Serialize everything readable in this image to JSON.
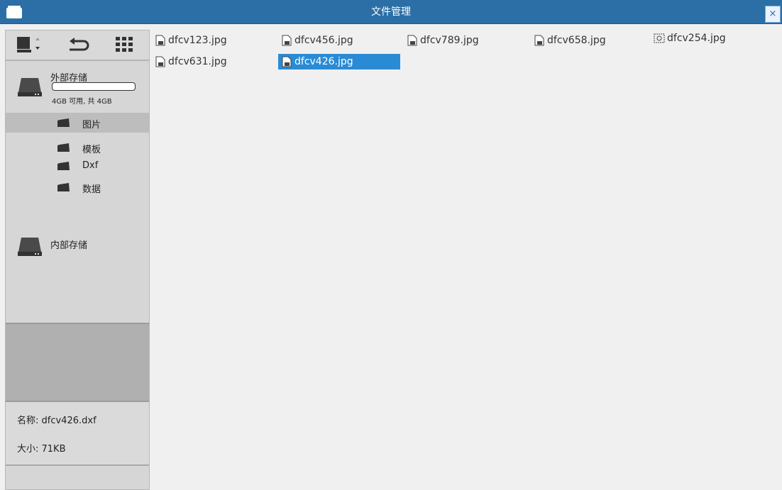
{
  "window": {
    "title": "文件管理",
    "close_label": "×"
  },
  "sidebar": {
    "external_drive": {
      "name": "外部存储",
      "capacity_text": "4GB 可用, 共 4GB"
    },
    "folders": [
      {
        "label": "图片",
        "selected": true
      },
      {
        "label": "模板",
        "selected": false
      },
      {
        "label": "Dxf",
        "selected": false
      },
      {
        "label": "数据",
        "selected": false
      }
    ],
    "internal_drive": {
      "name": "内部存储"
    },
    "info": {
      "name_line": "名称: dfcv426.dxf",
      "size_line": "大小: 71KB"
    }
  },
  "files": [
    {
      "name": "dfcv123.jpg",
      "icon": "image-file-icon",
      "selected": false
    },
    {
      "name": "dfcv456.jpg",
      "icon": "image-file-icon",
      "selected": false
    },
    {
      "name": "dfcv789.jpg",
      "icon": "image-file-icon",
      "selected": false
    },
    {
      "name": "dfcv658.jpg",
      "icon": "image-file-icon",
      "selected": false
    },
    {
      "name": "dfcv254.jpg",
      "icon": "broken-image-icon",
      "selected": false
    },
    {
      "name": "dfcv631.jpg",
      "icon": "image-file-icon",
      "selected": false
    },
    {
      "name": "dfcv426.jpg",
      "icon": "image-file-icon",
      "selected": true
    }
  ],
  "colors": {
    "titlebar": "#2b6fa6",
    "selection": "#2a8bd4",
    "sidebar": "#d6d6d6"
  }
}
